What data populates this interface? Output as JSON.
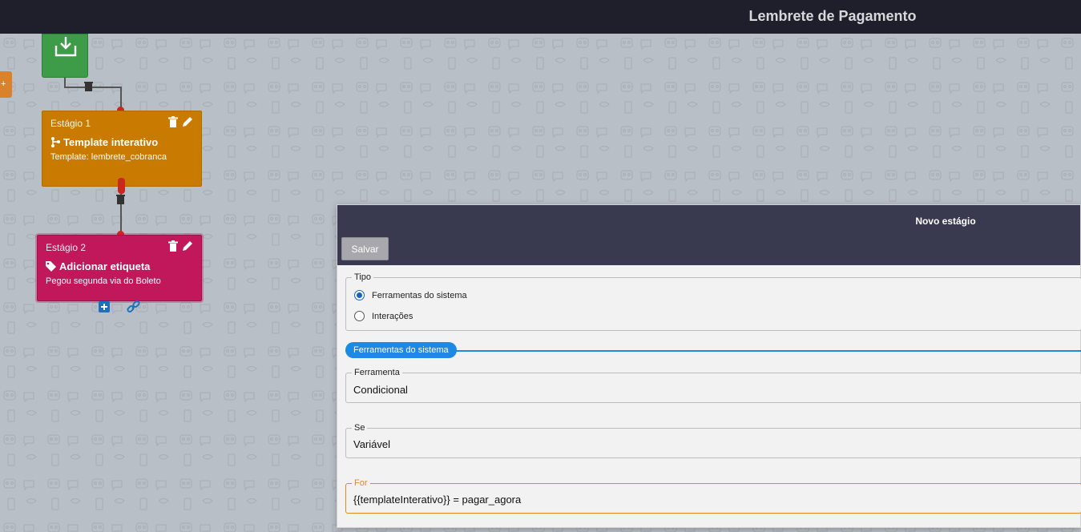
{
  "header": {
    "title": "Lembrete de Pagamento"
  },
  "side_tab": {
    "glyph": "+"
  },
  "flow": {
    "stages": [
      {
        "number_label": "Estágio 1",
        "type_label": "Template interativo",
        "detail_label": "Template:",
        "detail_value": "lembrete_cobranca",
        "color": "#c97a00"
      },
      {
        "number_label": "Estágio 2",
        "type_label": "Adicionar etiqueta",
        "detail_text": "Pegou segunda via do Boleto",
        "color": "#c0185a"
      }
    ]
  },
  "panel": {
    "title": "Novo estágio",
    "save_label": "Salvar",
    "tipo": {
      "legend": "Tipo",
      "options": [
        {
          "label": "Ferramentas do sistema",
          "checked": true
        },
        {
          "label": "Interações",
          "checked": false
        }
      ]
    },
    "section_label": "Ferramentas do sistema",
    "ferramenta": {
      "legend": "Ferramenta",
      "value": "Condicional"
    },
    "se": {
      "legend": "Se",
      "value": "Variável"
    },
    "for": {
      "legend": "For",
      "value": "{{templateInterativo}} = pagar_agora"
    }
  },
  "colors": {
    "accent_blue": "#1e88e5",
    "topbar": "#1f1f2b",
    "panel_header": "#393a4f",
    "start_node": "#3e9c48",
    "focus_orange": "#e08a1e"
  }
}
